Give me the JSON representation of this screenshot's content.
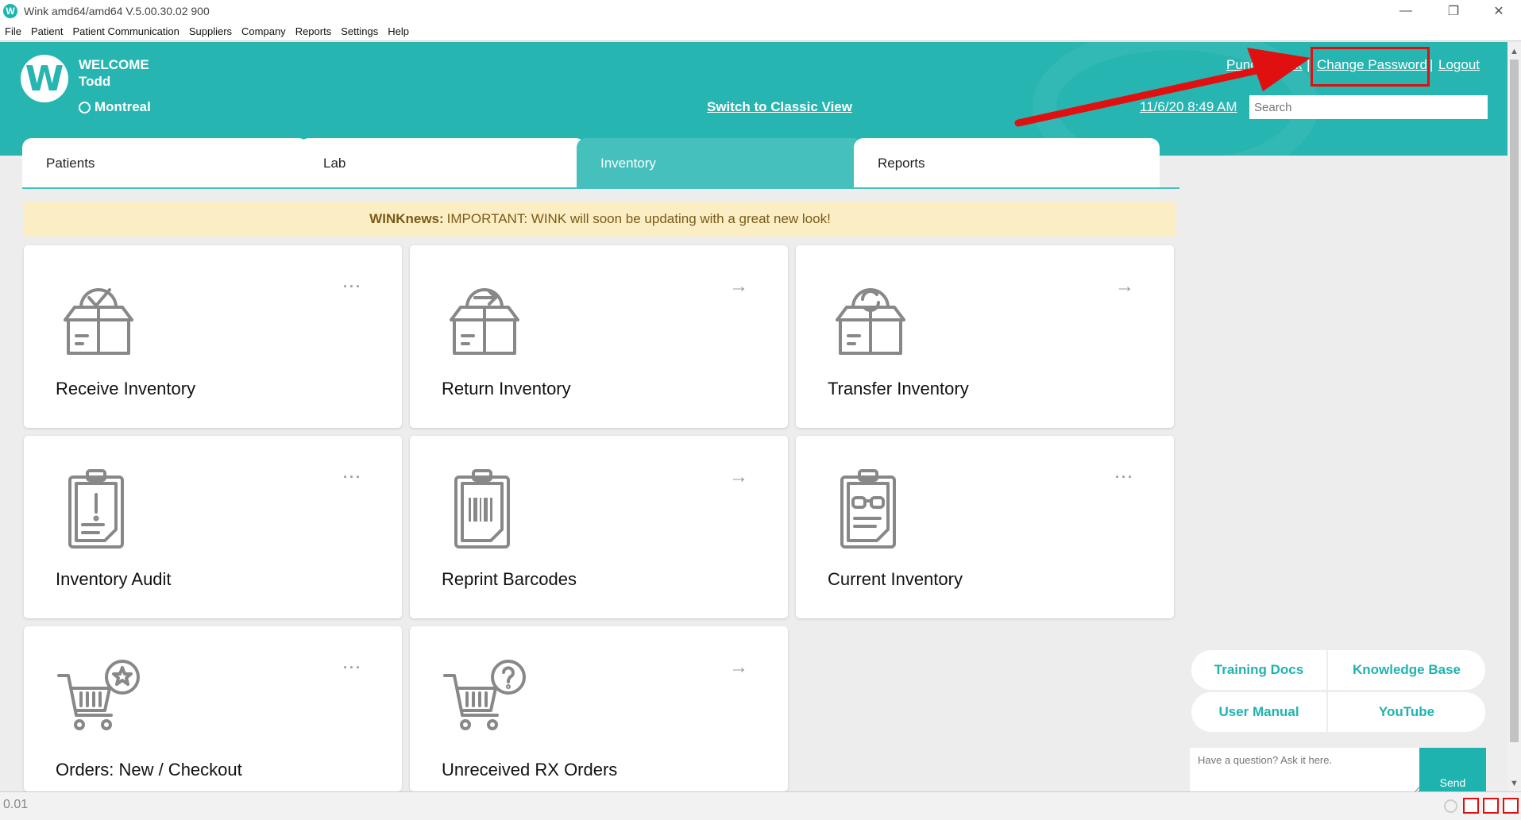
{
  "window": {
    "title": "Wink amd64/amd64 V.5.00.30.02 900",
    "app_icon": "W",
    "minimize": "—",
    "restore": "❐",
    "close": "✕"
  },
  "menu": [
    "File",
    "Patient",
    "Patient Communication",
    "Suppliers",
    "Company",
    "Reports",
    "Settings",
    "Help"
  ],
  "header": {
    "logo_letter": "W",
    "welcome": "WELCOME",
    "user": "Todd",
    "location": "Montreal",
    "classic_view": "Switch to Classic View",
    "punch_clock": "Punch Clock",
    "separator": "|",
    "change_password": "Change Password",
    "logout": "Logout",
    "datetime": "11/6/20 8:49 AM",
    "search_placeholder": "Search"
  },
  "tabs": [
    {
      "label": "Patients",
      "active": false
    },
    {
      "label": "Lab",
      "active": false
    },
    {
      "label": "Inventory",
      "active": true
    },
    {
      "label": "Reports",
      "active": false
    }
  ],
  "news": {
    "prefix": "WINKnews:",
    "message": "IMPORTANT: WINK will soon be updating with a great new look!"
  },
  "cards": [
    {
      "label": "Receive Inventory",
      "action": "···",
      "icon": "box-check-icon"
    },
    {
      "label": "Return Inventory",
      "action": "→",
      "icon": "box-return-icon"
    },
    {
      "label": "Transfer Inventory",
      "action": "→",
      "icon": "box-transfer-icon"
    },
    {
      "label": "Inventory Audit",
      "action": "···",
      "icon": "clipboard-alert-icon"
    },
    {
      "label": "Reprint Barcodes",
      "action": "→",
      "icon": "clipboard-barcode-icon"
    },
    {
      "label": "Current Inventory",
      "action": "···",
      "icon": "clipboard-glasses-icon"
    },
    {
      "label": "Orders: New / Checkout",
      "action": "···",
      "icon": "cart-star-icon"
    },
    {
      "label": "Unreceived RX Orders",
      "action": "→",
      "icon": "cart-question-icon"
    }
  ],
  "help": {
    "training_docs": "Training Docs",
    "knowledge_base": "Knowledge Base",
    "user_manual": "User Manual",
    "youtube": "YouTube",
    "ask_placeholder": "Have a question? Ask it here.",
    "send": "Send"
  },
  "status": {
    "text": "0.01"
  },
  "colors": {
    "brand_teal": "#27b5b1",
    "active_tab": "#45c0bc",
    "news_bg": "#fbedc4",
    "annotation_red": "#e01010"
  }
}
